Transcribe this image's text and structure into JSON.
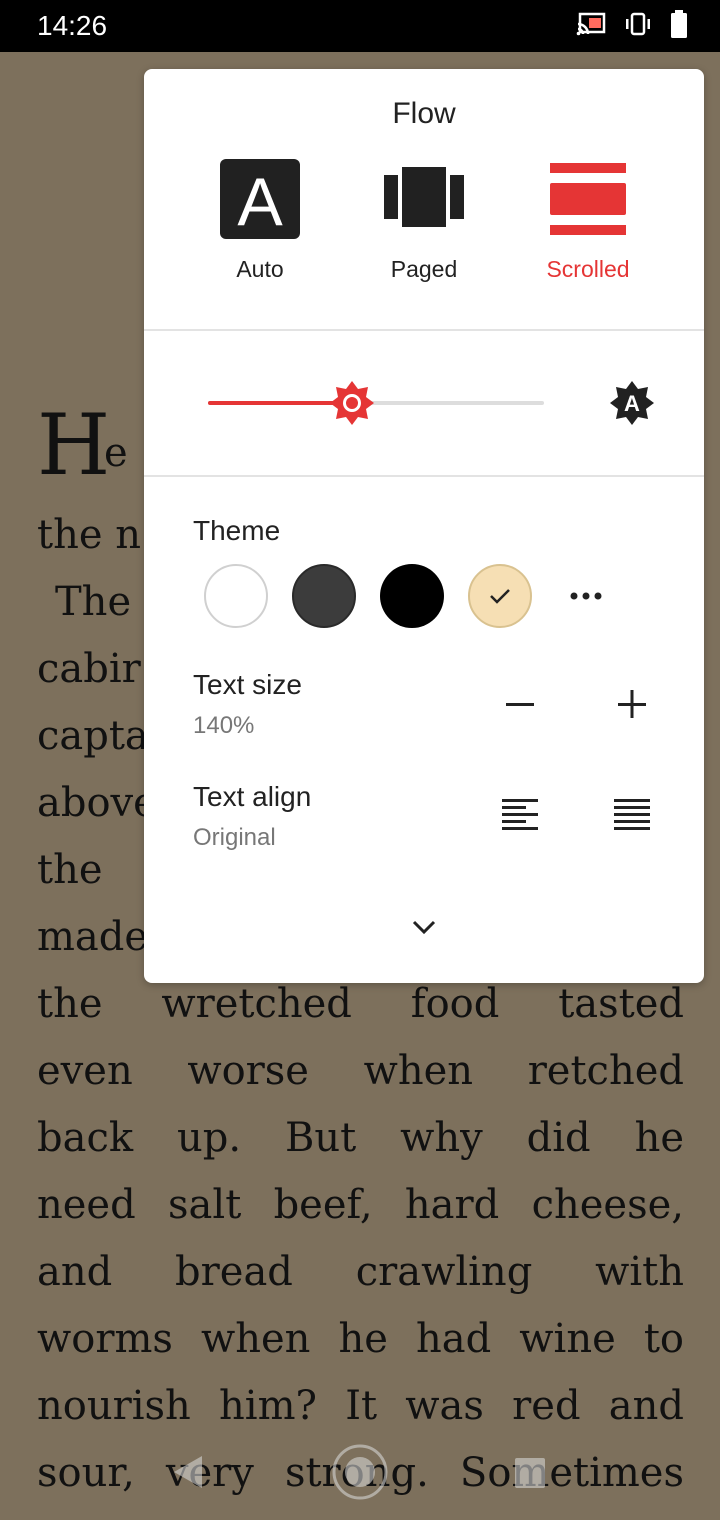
{
  "status_bar": {
    "time": "14:26",
    "icons": [
      "cast-icon",
      "vibrate-icon",
      "battery-icon"
    ]
  },
  "book": {
    "dropcap": "H",
    "dropcap_rest": "e",
    "lines": [
      "the n",
      "The",
      "cabir",
      "capta",
      "above",
      "the",
      "made",
      "the wretched food tasted",
      "even worse when retched",
      "back up. But why did he",
      "need salt beef, hard cheese,",
      "and bread crawling with",
      "worms when he had wine to",
      "nourish him? It was red and",
      "sour, very strong. Sometimes"
    ]
  },
  "panel": {
    "flow": {
      "title": "Flow",
      "options": [
        {
          "label": "Auto",
          "icon": "auto-flow-icon",
          "selected": false
        },
        {
          "label": "Paged",
          "icon": "paged-flow-icon",
          "selected": false
        },
        {
          "label": "Scrolled",
          "icon": "scrolled-flow-icon",
          "selected": true
        }
      ]
    },
    "brightness": {
      "value_fraction": 0.43,
      "accent_color": "#e53535",
      "auto_icon": "auto-brightness-icon"
    },
    "theme": {
      "label": "Theme",
      "options": [
        {
          "name": "white",
          "color": "#ffffff",
          "selected": false
        },
        {
          "name": "dark-gray",
          "color": "#3c3c3c",
          "selected": false
        },
        {
          "name": "black",
          "color": "#000000",
          "selected": false
        },
        {
          "name": "sepia",
          "color": "#f6dfb4",
          "selected": true
        }
      ],
      "more_icon": "more-horiz-icon"
    },
    "text_size": {
      "label": "Text size",
      "value": "140%",
      "decrease_icon": "minus-icon",
      "increase_icon": "plus-icon"
    },
    "text_align": {
      "label": "Text align",
      "value": "Original",
      "left_icon": "align-left-icon",
      "justify_icon": "align-justify-icon"
    },
    "expand_icon": "chevron-down-icon"
  },
  "nav_bar": {
    "icons": [
      "back-icon",
      "home-icon",
      "recents-icon"
    ]
  }
}
